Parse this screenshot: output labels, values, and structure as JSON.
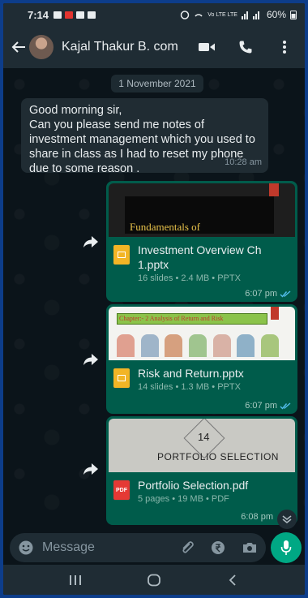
{
  "status_bar": {
    "time": "7:14",
    "battery": "60%",
    "network": "Vo LTE LTE"
  },
  "header": {
    "contact_name": "Kajal Thakur B. com",
    "back_icon": "arrow-left-icon",
    "video_icon": "videocam-icon",
    "call_icon": "phone-icon",
    "menu_icon": "more-vertical-icon"
  },
  "chat": {
    "date_chip": "1 November 2021",
    "incoming": {
      "text": "Good morning sir,\nCan you please send me notes of investment management which you used to share in class as I had to reset my phone due to some reason .",
      "time": "10:28 am"
    },
    "outgoing": [
      {
        "thumb_text": "Fundamentals of",
        "file_name": "Investment Overview Ch 1.pptx",
        "meta": "16 slides • 2.4 MB • PPTX",
        "time": "6:07 pm",
        "file_type": "pptx"
      },
      {
        "thumb_text": "Chapter:- 2  Analysis of Return and Risk",
        "file_name": "Risk and Return.pptx",
        "meta": "14 slides • 1.3 MB • PPTX",
        "time": "6:07 pm",
        "file_type": "pptx"
      },
      {
        "thumb_number": "14",
        "thumb_text": "PORTFOLIO SELECTION",
        "file_name": "Portfolio Selection.pdf",
        "meta": "5 pages • 19 MB • PDF",
        "file_icon_label": "PDF",
        "time": "6:08 pm",
        "file_type": "pdf"
      }
    ]
  },
  "input_bar": {
    "placeholder": "Message"
  },
  "colors": {
    "outgoing_bubble": "#005c4b",
    "incoming_bubble": "#202c33",
    "accent": "#00a884",
    "read_ticks": "#53bdeb"
  }
}
